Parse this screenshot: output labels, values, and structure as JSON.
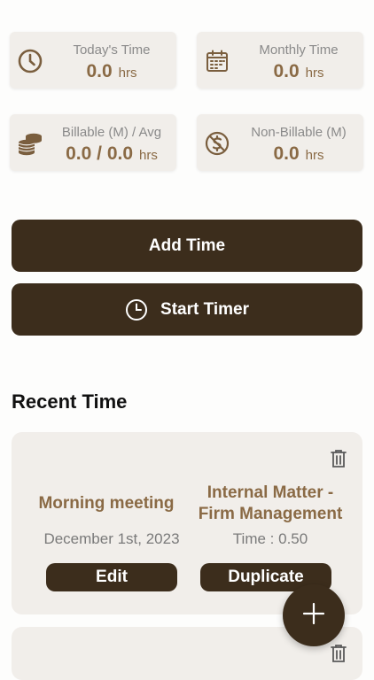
{
  "stats": {
    "today": {
      "label": "Today's Time",
      "value": "0.0",
      "unit": "hrs",
      "icon": "clock-icon"
    },
    "monthly": {
      "label": "Monthly Time",
      "value": "0.0",
      "unit": "hrs",
      "icon": "calendar-icon"
    },
    "billable": {
      "label": "Billable (M) / Avg",
      "value": "0.0 / 0.0",
      "unit": "hrs",
      "icon": "coins-icon"
    },
    "non_billable": {
      "label": "Non-Billable (M)",
      "value": "0.0",
      "unit": "hrs",
      "icon": "no-dollar-icon"
    }
  },
  "actions": {
    "add_time": "Add Time",
    "start_timer": "Start Timer"
  },
  "recent": {
    "title": "Recent Time",
    "entries": [
      {
        "description": "Morning meeting",
        "matter": "Internal Matter - Firm Management",
        "date": "December 1st, 2023",
        "time": "Time : 0.50",
        "edit_label": "Edit",
        "duplicate_label": "Duplicate"
      }
    ]
  },
  "colors": {
    "accent": "#3c2d1c",
    "brand_text": "#8a6a45",
    "card_bg": "#f1eeea"
  }
}
